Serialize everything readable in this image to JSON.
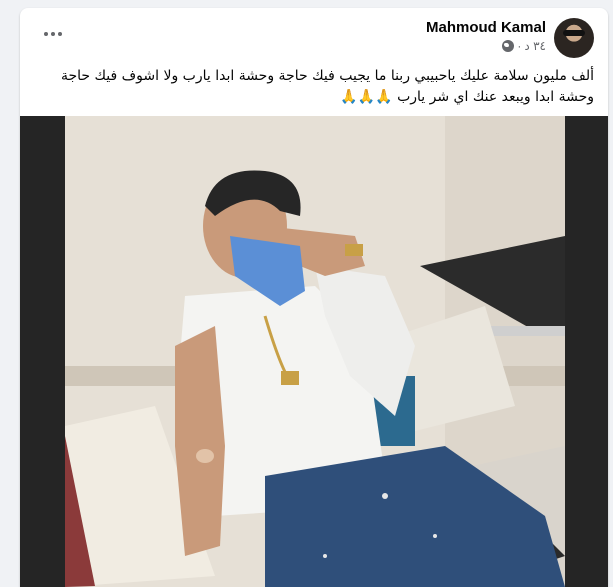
{
  "post": {
    "author": "Mahmoud Kamal",
    "time": "٣٤ د",
    "text": "ألف مليون سلامة عليك ياحبيبي ربنا ما يجيب فيك حاجة وحشة ابدا يارب ولا اشوف فيك حاجة وحشة ابدا ويبعد عنك اي شر يارب 🙏🙏🙏",
    "privacy_icon": "globe-icon",
    "more_icon": "more-options-icon"
  },
  "colors": {
    "background": "#f0f2f5",
    "card": "#ffffff",
    "secondary_text": "#65676b",
    "photo_letterbox": "#252525"
  }
}
